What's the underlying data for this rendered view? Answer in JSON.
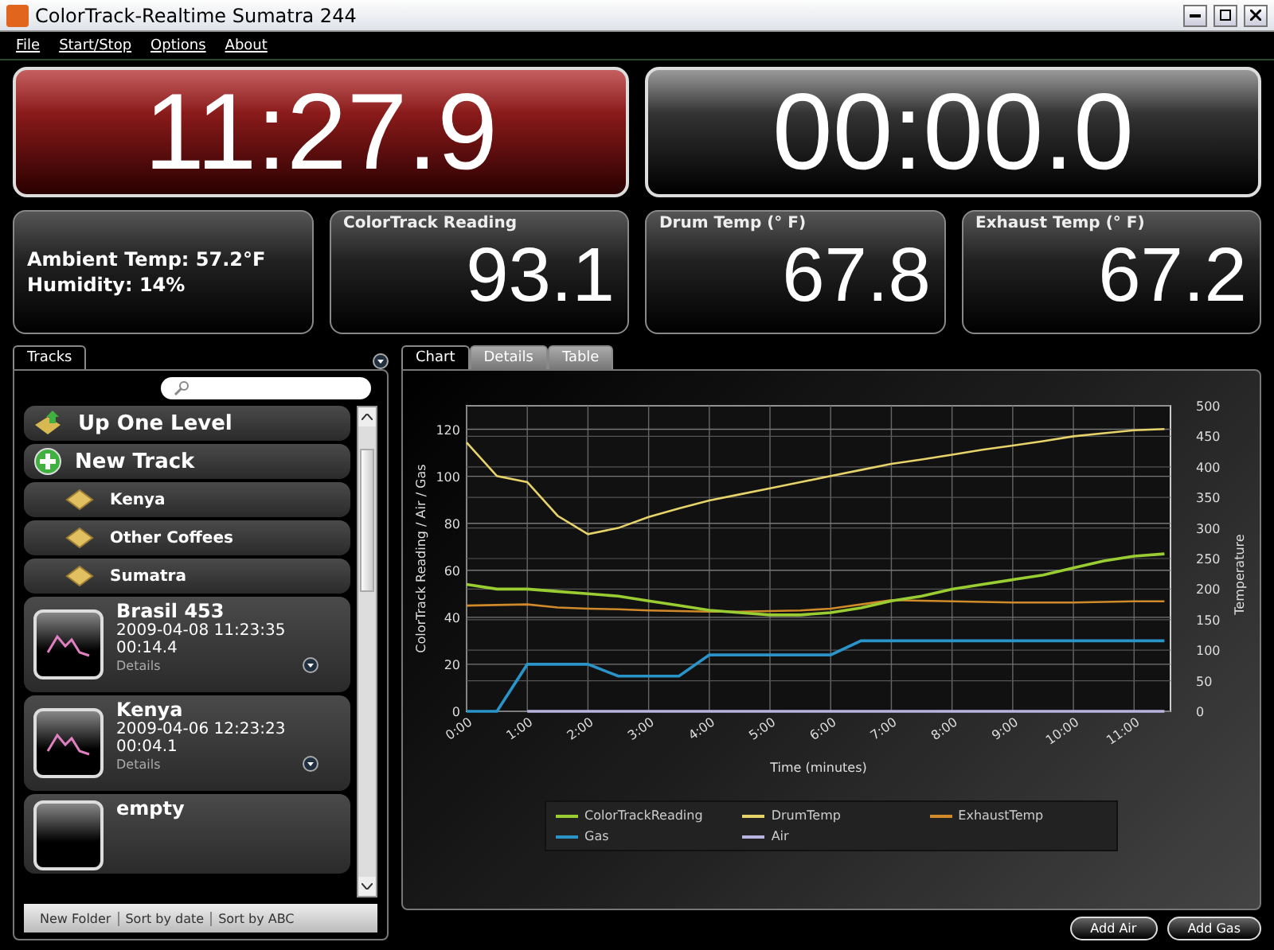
{
  "window": {
    "title": "ColorTrack-Realtime Sumatra 244"
  },
  "menu": [
    "File",
    "Start/Stop",
    "Options",
    "About"
  ],
  "timers": [
    {
      "value": "11:27.9",
      "running": true
    },
    {
      "value": "00:00.0",
      "running": false
    }
  ],
  "ambient": {
    "lines": [
      "Ambient Temp:  57.2°F",
      "Humidity:  14%"
    ]
  },
  "readings": [
    {
      "label": "ColorTrack Reading",
      "value": "93.1"
    },
    {
      "label": "Drum Temp (° F)",
      "value": "67.8"
    },
    {
      "label": "Exhaust Temp (° F)",
      "value": "67.2"
    }
  ],
  "tracks_panel": {
    "tabs": [
      {
        "label": "Tracks",
        "selected": true
      }
    ],
    "items": [
      {
        "kind": "up",
        "label": "Up One Level"
      },
      {
        "kind": "new",
        "label": "New Track"
      },
      {
        "kind": "folder",
        "label": "Kenya"
      },
      {
        "kind": "folder",
        "label": "Other Coffees"
      },
      {
        "kind": "folder",
        "label": "Sumatra"
      },
      {
        "kind": "track",
        "label": "Brasil 453",
        "date": "2009-04-08 11:23:35",
        "duration": "00:14.4",
        "details": "Details"
      },
      {
        "kind": "track",
        "label": "Kenya",
        "date": "2009-04-06 12:23:23",
        "duration": "00:04.1",
        "details": "Details"
      },
      {
        "kind": "track",
        "label": "empty"
      }
    ],
    "toolbar": [
      "New Folder",
      "Sort by date",
      "Sort by ABC"
    ]
  },
  "chart_tabs": [
    {
      "label": "Chart",
      "selected": true
    },
    {
      "label": "Details",
      "selected": false
    },
    {
      "label": "Table",
      "selected": false
    }
  ],
  "chart": {
    "chart_data": {
      "type": "line",
      "xlabel": "Time (minutes)",
      "ylabel": "ColorTrack Reading / Air / Gas",
      "y2label": "Temperature",
      "x": [
        0,
        0.5,
        1,
        1.5,
        2,
        2.5,
        3,
        3.5,
        4,
        4.5,
        5,
        5.5,
        6,
        6.5,
        7,
        7.5,
        8,
        8.5,
        9,
        9.5,
        10,
        10.5,
        11,
        11.5
      ],
      "xlim": [
        0,
        11.6
      ],
      "ylim": [
        0,
        130
      ],
      "y2lim": [
        0,
        500
      ],
      "xticks": [
        {
          "value": 0,
          "label": "0:00"
        },
        {
          "value": 1,
          "label": "1:00"
        },
        {
          "value": 2,
          "label": "2:00"
        },
        {
          "value": 3,
          "label": "3:00"
        },
        {
          "value": 4,
          "label": "4:00"
        },
        {
          "value": 5,
          "label": "5:00"
        },
        {
          "value": 6,
          "label": "6:00"
        },
        {
          "value": 7,
          "label": "7:00"
        },
        {
          "value": 8,
          "label": "8:00"
        },
        {
          "value": 9,
          "label": "9:00"
        },
        {
          "value": 10,
          "label": "10:00"
        },
        {
          "value": 11,
          "label": "11:00"
        }
      ],
      "yticks": [
        0,
        20,
        40,
        60,
        80,
        100,
        120
      ],
      "grid": true,
      "y2ticks": [
        0,
        50,
        100,
        150,
        200,
        250,
        300,
        350,
        400,
        450,
        500
      ],
      "series": [
        {
          "name": "ColorTrackReading",
          "color": "#9acd32",
          "values": [
            54,
            52,
            52,
            51,
            50,
            49,
            47,
            45,
            43,
            42,
            41,
            41,
            42,
            44,
            47,
            49,
            52,
            54,
            56,
            58,
            61,
            64,
            66,
            67
          ]
        },
        {
          "name": "DrumTemp",
          "color": "#e6d36a",
          "axis": "y2",
          "values": [
            440,
            385,
            375,
            320,
            290,
            300,
            318,
            332,
            345,
            355,
            365,
            375,
            385,
            395,
            405,
            412,
            420,
            428,
            435,
            442,
            450,
            455,
            460,
            462
          ]
        },
        {
          "name": "ExhaustTemp",
          "color": "#d08a2a",
          "axis": "y2",
          "values": [
            173,
            174,
            175,
            170,
            168,
            167,
            165,
            164,
            163,
            163,
            164,
            165,
            168,
            175,
            182,
            181,
            180,
            179,
            178,
            178,
            178,
            179,
            180,
            180
          ]
        },
        {
          "name": "Gas",
          "color": "#2a93c8",
          "values": [
            0,
            0,
            20,
            20,
            20,
            15,
            15,
            15,
            24,
            24,
            24,
            24,
            24,
            30,
            30,
            30,
            30,
            30,
            30,
            30,
            30,
            30,
            30,
            30
          ]
        },
        {
          "name": "Air",
          "color": "#b8b4e0",
          "values": [
            null,
            null,
            0,
            0,
            0,
            0,
            0,
            0,
            0,
            0,
            0,
            0,
            0,
            0,
            0,
            0,
            0,
            0,
            0,
            0,
            0,
            0,
            0,
            0
          ]
        }
      ]
    }
  },
  "buttons": [
    "Add Air",
    "Add Gas"
  ]
}
